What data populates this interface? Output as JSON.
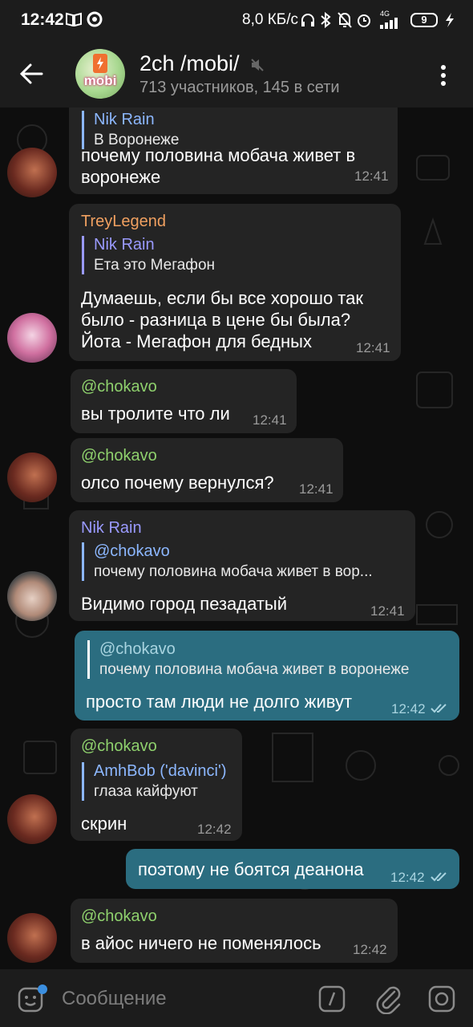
{
  "status_bar": {
    "time": "12:42",
    "network_speed": "8,0 КБ/с",
    "network_type": "4G",
    "battery": "9"
  },
  "header": {
    "title": "2ch /mobi/",
    "subtitle": "713 участников, 145 в сети",
    "avatar_text": "mobi"
  },
  "messages": [
    {
      "id": "m1",
      "reply_name": "Nik Rain",
      "reply_text": "В Воронеже",
      "text_line1": "почему половина мобача живет в",
      "text_line2": "воронеже",
      "time": "12:41"
    },
    {
      "id": "m2",
      "sender": "TreyLegend",
      "reply_name": "Nik Rain",
      "reply_text": "Ета это Мегафон",
      "text_line1": "Думаешь, если бы все хорошо так",
      "text_line2": "было - разница в цене бы была?",
      "text_line3": "Йота - Мегафон для бедных",
      "time": "12:41"
    },
    {
      "id": "m3",
      "mention": "@chokavo",
      "text": "вы тролите что ли",
      "time": "12:41"
    },
    {
      "id": "m4",
      "mention": "@chokavo",
      "text": "олсо почему вернулся?",
      "time": "12:41"
    },
    {
      "id": "m5",
      "sender": "Nik Rain",
      "reply_name": "@chokavo",
      "reply_text": "почему половина мобача живет в вор...",
      "text": "Видимо город пезадатый",
      "time": "12:41"
    },
    {
      "id": "m6",
      "reply_name": "@chokavo",
      "reply_text": "почему половина мобача живет в воронеже",
      "text": "просто там люди не долго живут",
      "time": "12:42"
    },
    {
      "id": "m7",
      "mention": "@chokavo",
      "reply_name": "AmhBob ('davinci')",
      "reply_text": "глаза кайфуют",
      "text": "скрин",
      "time": "12:42"
    },
    {
      "id": "m8",
      "text": "поэтому не боятся деанона",
      "time": "12:42"
    },
    {
      "id": "m9",
      "mention": "@chokavo",
      "text": "в айос ничего не поменялось",
      "time": "12:42"
    }
  ],
  "input": {
    "placeholder": "Сообщение"
  },
  "colors": {
    "incoming_bubble": "#242424",
    "outgoing_bubble": "#2b6d80",
    "name_orange": "#f0a060",
    "name_purple": "#9a9aff",
    "mention_green": "#8fd16d",
    "reply_blue": "#8cb7ff"
  }
}
